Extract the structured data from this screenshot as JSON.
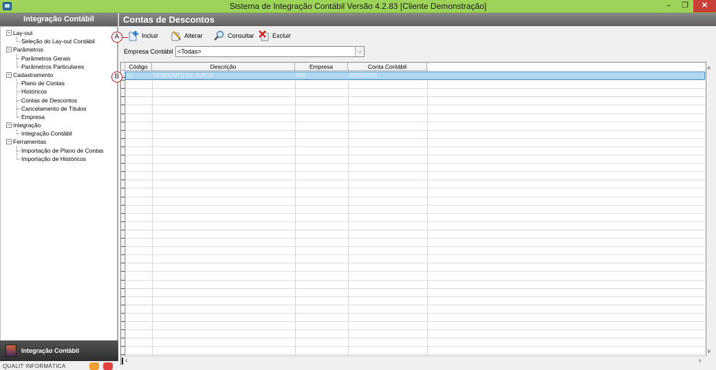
{
  "window": {
    "title": "Sistema de Integração Contábil Versão 4.2.83 [Cliente Demonstração]",
    "minimize": "–",
    "maximize": "❐",
    "close": "✕"
  },
  "left_panel": {
    "header": "Integração Contábil",
    "tree": [
      {
        "label": "Lay-out",
        "children": [
          "Seleção do Lay-out Contábil"
        ]
      },
      {
        "label": "Parâmetros",
        "children": [
          "Parâmetros Gerais",
          "Parâmetros Particulares"
        ]
      },
      {
        "label": "Cadastramento",
        "children": [
          "Plano de Contas",
          "Históricos",
          "Contas de Descontos",
          "Cancelamento de Títulos",
          "Empresa"
        ]
      },
      {
        "label": "Integração",
        "children": [
          "Integração Contábil"
        ]
      },
      {
        "label": "Ferramentas",
        "children": [
          "Importação de Plano de Contas",
          "Importação de Históricos"
        ]
      }
    ],
    "module_label": "Integração Contábil",
    "footer_text": "QUALIT INFORMÁTICA"
  },
  "main": {
    "title": "Contas de Descontos",
    "toolbar": {
      "add": "Incluir",
      "edit": "Alterar",
      "query": "Consultar",
      "delete": "Excluir"
    },
    "filter": {
      "label": "Empresa Contábil",
      "value": "<Todas>"
    },
    "grid": {
      "columns": [
        "Código",
        "Descrição",
        "Empresa",
        "Conta Contábil"
      ],
      "rows": [
        [
          "0J",
          "DESCONTO DE JUROS",
          "000",
          "000000002"
        ]
      ],
      "empty_rows": 30
    }
  },
  "annotations": {
    "a": "A",
    "b": "B",
    "color": "#c01818"
  },
  "colors": {
    "titlebar": "#9ed35a",
    "panel_header": "#6f6f6f",
    "selected_row": "#b2d7f0",
    "close_button": "#c7403a"
  }
}
